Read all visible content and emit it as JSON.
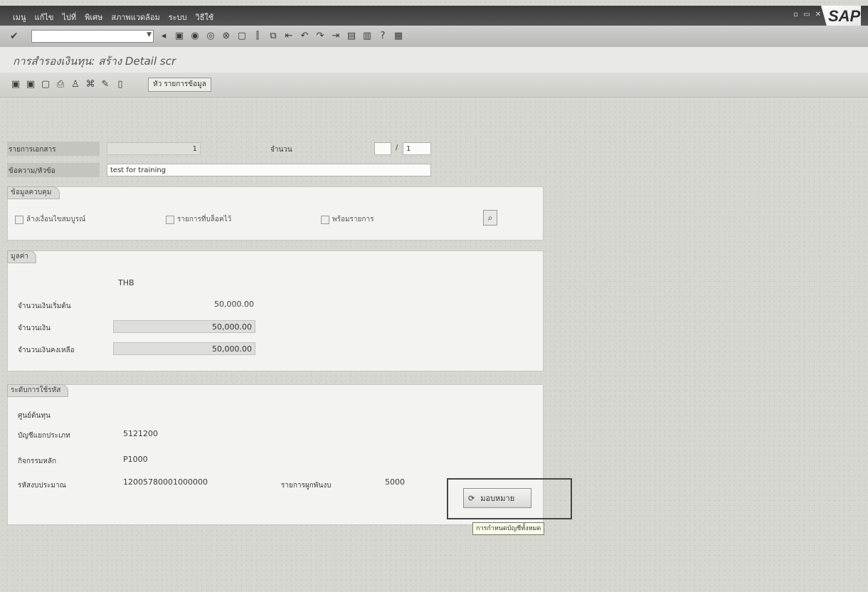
{
  "menubar": {
    "items": [
      "เมนู",
      "แก้ไข",
      "ไปที่",
      "พิเศษ",
      "สภาพแวดล้อม",
      "ระบบ",
      "วิธีใช้"
    ],
    "win_controls": "▫ ▭ ✕",
    "logo": "SAP"
  },
  "system_toolbar": {
    "command_field_value": "",
    "icons": [
      "enter-icon",
      "save-icon",
      "back-icon",
      "exit-icon",
      "cancel-icon",
      "print-icon",
      "find-icon",
      "find-next-icon",
      "first-page-icon",
      "prev-page-icon",
      "next-page-icon",
      "last-page-icon",
      "new-session-icon",
      "shortcut-icon",
      "help-icon",
      "layout-icon"
    ]
  },
  "title": "การสำรองเงินทุน: สร้าง Detail scr",
  "app_toolbar": {
    "icons": [
      "display-icon",
      "change-icon",
      "create-icon",
      "print-icon",
      "user-icon",
      "attach-icon",
      "edit-icon",
      "delete-icon"
    ],
    "header_button": "หัว รายการข้อมูล"
  },
  "form": {
    "doc_item_label": "รายการเอกสาร",
    "doc_item_value": "1",
    "quantity_label": "จำนวน",
    "quantity_value": "1",
    "text_label": "ข้อความ/หัวข้อ",
    "text_value": "test for training"
  },
  "group_status": {
    "title": "ข้อมูลควบคุม",
    "cb1": "ล้างเงื่อนไขสมบูรณ์",
    "cb2": "รายการที่บล็อคไว้",
    "cb3": "พร้อมรายการ"
  },
  "group_amounts": {
    "title": "มูลค่า",
    "currency": "THB",
    "rows": [
      {
        "label": "จำนวนเงินเริ่มต้น",
        "value": "50,000.00"
      },
      {
        "label": "จำนวนเงิน",
        "value": "50,000.00"
      },
      {
        "label": "จำนวนเงินคงเหลือ",
        "value": "50,000.00"
      }
    ]
  },
  "group_assignment": {
    "title": "ระดับการใช้รหัส",
    "cost_center_label": "ศูนย์ต้นทุน",
    "gl_label": "บัญชีแยกประเภท",
    "gl_value": "5121200",
    "fund_label": "กิจกรรมหลัก",
    "fund_value": "P1000",
    "budget_label": "รหัสงบประมาณ",
    "budget_value": "12005780001000000",
    "commitment_label": "รายการผูกพันงบ",
    "commitment_value": "5000"
  },
  "assign_button": "มอบหมาย",
  "tooltip": "การกำหนดบัญชีทั้งหมด"
}
